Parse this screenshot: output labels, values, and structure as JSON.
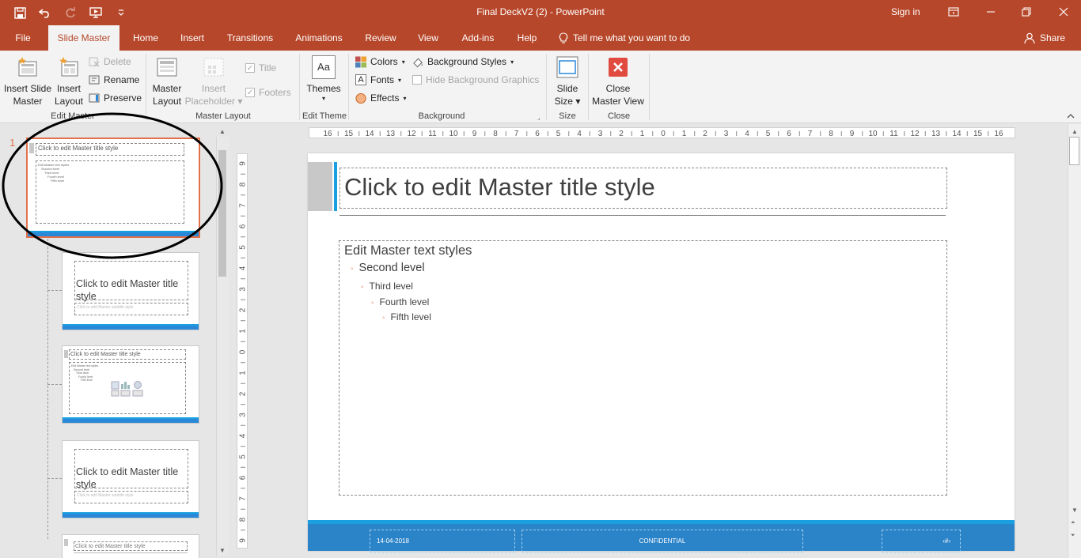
{
  "window": {
    "title": "Final DeckV2 (2)  -  PowerPoint",
    "sign_in": "Sign in"
  },
  "tabs": [
    {
      "label": "File"
    },
    {
      "label": "Slide Master"
    },
    {
      "label": "Home"
    },
    {
      "label": "Insert"
    },
    {
      "label": "Transitions"
    },
    {
      "label": "Animations"
    },
    {
      "label": "Review"
    },
    {
      "label": "View"
    },
    {
      "label": "Add-ins"
    },
    {
      "label": "Help"
    }
  ],
  "tell_me": "Tell me what you want to do",
  "share": "Share",
  "ribbon": {
    "edit_master": {
      "label": "Edit Master",
      "insert_slide_master": [
        "Insert Slide",
        "Master"
      ],
      "insert_layout": [
        "Insert",
        "Layout"
      ],
      "delete": "Delete",
      "rename": "Rename",
      "preserve": "Preserve"
    },
    "master_layout": {
      "label": "Master Layout",
      "master_layout_btn": [
        "Master",
        "Layout"
      ],
      "insert_placeholder": [
        "Insert",
        "Placeholder"
      ],
      "title": "Title",
      "footers": "Footers"
    },
    "edit_theme": {
      "label": "Edit Theme",
      "themes": "Themes",
      "themes_glyph": "Aa"
    },
    "background": {
      "label": "Background",
      "colors": "Colors",
      "fonts": "Fonts",
      "fonts_glyph": "A",
      "effects": "Effects",
      "background_styles": "Background Styles",
      "hide_bg_graphics": "Hide Background Graphics"
    },
    "size": {
      "label": "Size",
      "slide_size": [
        "Slide",
        "Size"
      ]
    },
    "close": {
      "label": "Close",
      "close_master_view": [
        "Close",
        "Master View"
      ]
    }
  },
  "thumbnails": {
    "master_number": "1",
    "master_title": "Click to edit Master title style",
    "master_body_lines": [
      "Edit Master text styles",
      "Second level",
      "Third level",
      "Fourth level",
      "Fifth level"
    ],
    "layout_title_large": "Click to edit Master title style",
    "layout_title_small": "Click to edit Master title style",
    "layout_subtitle": "Click to edit Master subtitle style"
  },
  "ruler": {
    "h_ticks": [
      "16",
      "15",
      "14",
      "13",
      "12",
      "11",
      "10",
      "9",
      "8",
      "7",
      "6",
      "5",
      "4",
      "3",
      "2",
      "1",
      "0",
      "1",
      "2",
      "3",
      "4",
      "5",
      "6",
      "7",
      "8",
      "9",
      "10",
      "11",
      "12",
      "13",
      "14",
      "15",
      "16"
    ],
    "v_ticks": [
      "9",
      "8",
      "7",
      "6",
      "5",
      "4",
      "3",
      "2",
      "1",
      "0",
      "1",
      "2",
      "3",
      "4",
      "5",
      "6",
      "7",
      "8",
      "9"
    ]
  },
  "slide": {
    "title": "Click to edit Master title style",
    "levels": [
      "Edit Master text styles",
      "Second level",
      "Third level",
      "Fourth level",
      "Fifth level"
    ],
    "footer_date": "14-04-2018",
    "footer_center": "CONFIDENTIAL",
    "footer_number": "‹#›"
  },
  "colors": {
    "brand": "#b7472a",
    "accent_orange": "#e2714a",
    "footer_blue": "#2b83c8",
    "accent_cyan": "#1aa0e0"
  }
}
